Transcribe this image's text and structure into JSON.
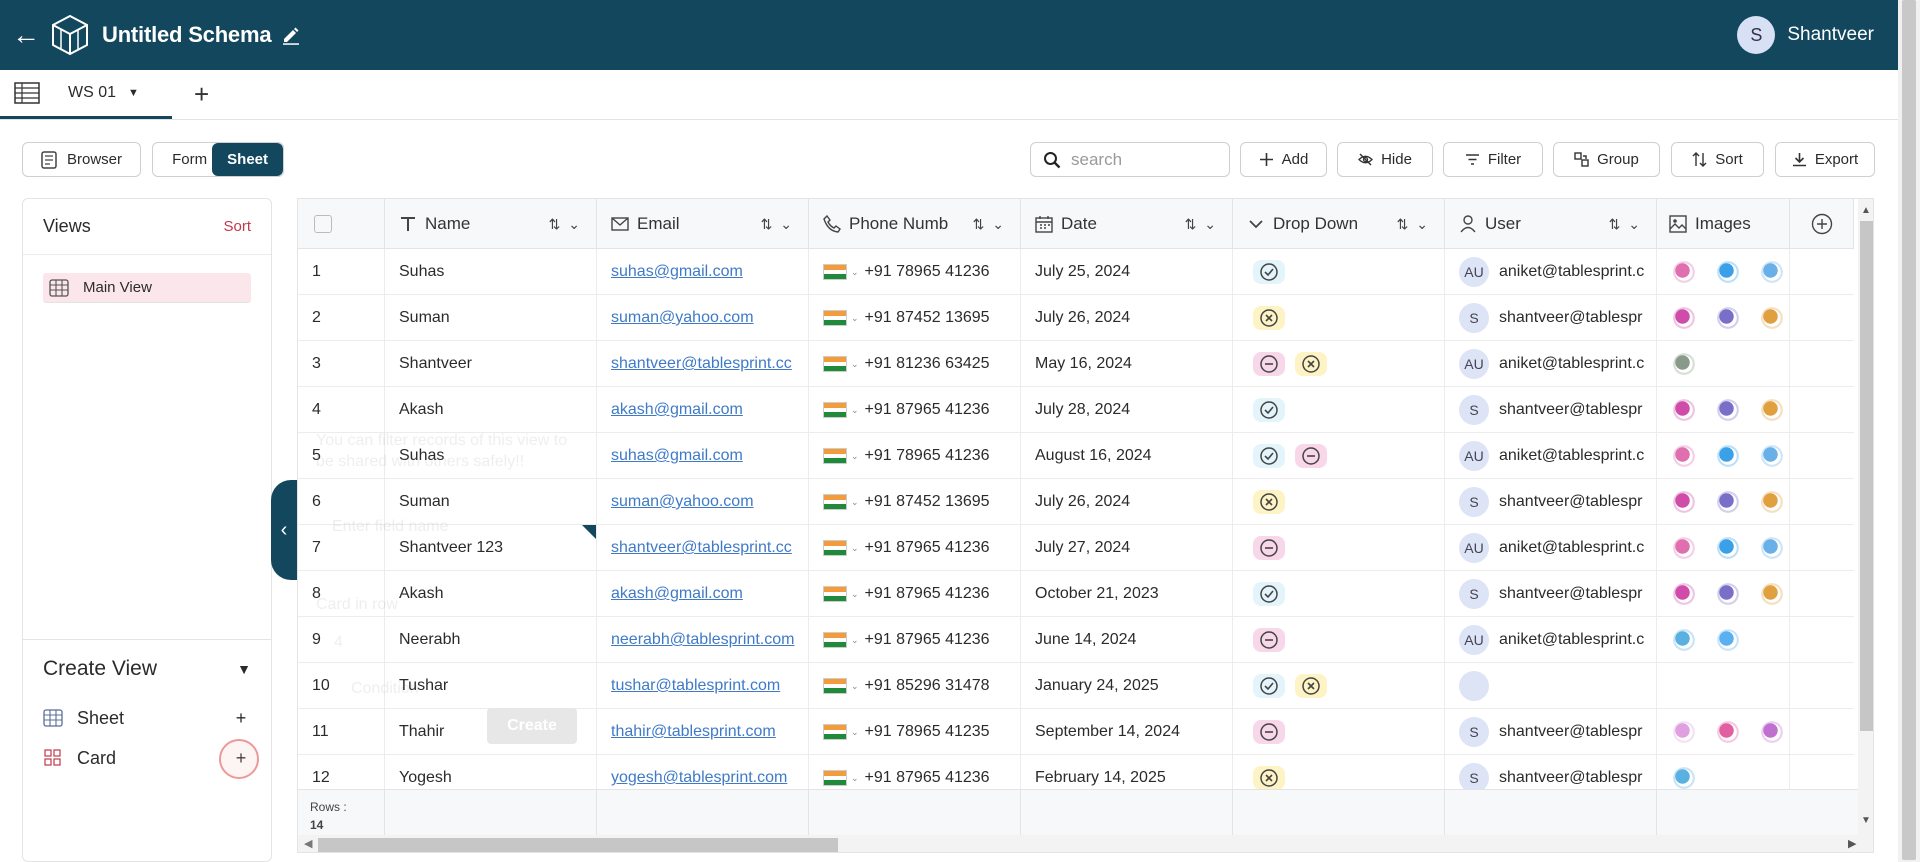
{
  "header": {
    "title": "Untitled Schema",
    "user_initial": "S",
    "user_name": "Shantveer"
  },
  "tabs": [
    {
      "label": "WS 01"
    }
  ],
  "toolbar": {
    "browser_label": "Browser",
    "form_label": "Form",
    "sheet_label": "Sheet",
    "search_placeholder": "search",
    "add_label": "Add",
    "hide_label": "Hide",
    "filter_label": "Filter",
    "group_label": "Group",
    "sort_label": "Sort",
    "export_label": "Export"
  },
  "sidebar": {
    "views_title": "Views",
    "sort_label": "Sort",
    "views": [
      {
        "label": "Main View"
      }
    ],
    "create_title": "Create View",
    "create_items": [
      {
        "label": "Sheet"
      },
      {
        "label": "Card"
      }
    ]
  },
  "table": {
    "columns": [
      "Name",
      "Email",
      "Phone Numb",
      "Date",
      "Drop Down",
      "User",
      "Images"
    ],
    "rows": [
      {
        "n": "1",
        "name": "Suhas",
        "email": "suhas@gmail.com",
        "phone": "+91 78965 41236",
        "date": "July 25, 2024",
        "user_init": "AU",
        "user": "aniket@tablesprint.c"
      },
      {
        "n": "2",
        "name": "Suman",
        "email": "suman@yahoo.com",
        "phone": "+91 87452 13695",
        "date": "July 26, 2024",
        "user_init": "S",
        "user": "shantveer@tablespr"
      },
      {
        "n": "3",
        "name": "Shantveer",
        "email": "shantveer@tablesprint.cc",
        "phone": "+91 81236 63425",
        "date": "May 16, 2024",
        "user_init": "AU",
        "user": "aniket@tablesprint.c"
      },
      {
        "n": "4",
        "name": "Akash",
        "email": "akash@gmail.com",
        "phone": "+91 87965 41236",
        "date": "July 28, 2024",
        "user_init": "S",
        "user": "shantveer@tablespr"
      },
      {
        "n": "5",
        "name": "Suhas",
        "email": "suhas@gmail.com",
        "phone": "+91 78965 41236",
        "date": "August 16, 2024",
        "user_init": "AU",
        "user": "aniket@tablesprint.c"
      },
      {
        "n": "6",
        "name": "Suman",
        "email": "suman@yahoo.com",
        "phone": "+91 87452 13695",
        "date": "July 26, 2024",
        "user_init": "S",
        "user": "shantveer@tablespr"
      },
      {
        "n": "7",
        "name": "Shantveer 123",
        "email": "shantveer@tablesprint.cc",
        "phone": "+91 87965 41236",
        "date": "July 27, 2024",
        "user_init": "AU",
        "user": "aniket@tablesprint.c"
      },
      {
        "n": "8",
        "name": "Akash",
        "email": "akash@gmail.com",
        "phone": "+91 87965 41236",
        "date": "October 21, 2023",
        "user_init": "S",
        "user": "shantveer@tablespr"
      },
      {
        "n": "9",
        "name": "Neerabh",
        "email": "neerabh@tablesprint.com",
        "phone": "+91 87965 41236",
        "date": "June 14, 2024",
        "user_init": "AU",
        "user": "aniket@tablesprint.c"
      },
      {
        "n": "10",
        "name": "Tushar",
        "email": "tushar@tablesprint.com",
        "phone": "+91 85296 31478",
        "date": "January 24, 2025",
        "user_init": "",
        "user": ""
      },
      {
        "n": "11",
        "name": "Thahir",
        "email": "thahir@tablesprint.com",
        "phone": "+91 78965 41235",
        "date": "September 14, 2024",
        "user_init": "S",
        "user": "shantveer@tablespr"
      },
      {
        "n": "12",
        "name": "Yogesh",
        "email": "yogesh@tablesprint.com",
        "phone": "+91 87965 41236",
        "date": "February 14, 2025",
        "user_init": "S",
        "user": "shantveer@tablespr"
      }
    ],
    "footer_rows_label": "Rows :",
    "footer_rows_count": "14"
  },
  "ghost": {
    "hint": "You can filter records of this view to be shared with others safely!!",
    "placeholder": "Enter field name",
    "card_label": "Card in row",
    "card_value": "4",
    "condition": "Condition",
    "create": "Create"
  },
  "colors": {
    "brand": "#12475e",
    "accent": "#c0394b",
    "link": "#3f7ac8"
  }
}
